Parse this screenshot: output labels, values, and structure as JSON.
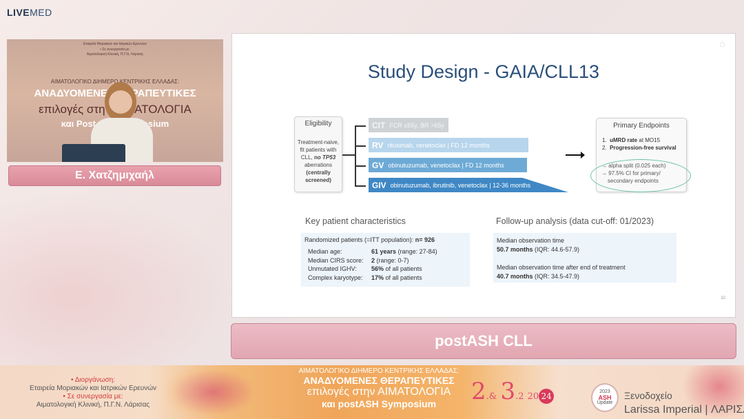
{
  "brand": {
    "part1": "LIVE",
    "part2": "MED"
  },
  "video": {
    "line1": "Εταιρεία Μοριακών και Ιατρικών Ερευνών",
    "line2": "• Σε συνεργασία με:",
    "line3": "Αιματολογική Κλινική, Π.Γ.Ν. Λάρισας",
    "line4": "ΑΙΜΑΤΟΛΟΓΙΚΟ ΔΙΗΜΕΡΟ ΚΕΝΤΡΙΚΗΣ ΕΛΛΑΔΑΣ:",
    "line5": "ΑΝΑΔΥΟΜΕΝΕΣ ΘΕΡΑΠΕΥΤΙΚΕΣ",
    "line6": "επιλογές στην ΑΙΜΑΤΟΛΟΓΙΑ",
    "line7": "και Post-Ash Symposium"
  },
  "speaker_name": "Ε. Χατζημιχαήλ",
  "slide": {
    "title": "Study Design - GAIA/CLL13",
    "eligibility": {
      "heading": "Eligibility",
      "text_a": "Treatment-naive, fit patients with CLL,",
      "no_label": "no",
      "tp53": "TP53",
      "text_b": "aberrations",
      "centrally": "(centrally screened)"
    },
    "arms": [
      {
        "code": "CIT",
        "desc": "FCR ≤65y, BR >65y"
      },
      {
        "code": "RV",
        "desc": "rituximab, venetoclax | FD 12 months"
      },
      {
        "code": "GV",
        "desc": "obinutuzumab, venetoclax | FD 12 months"
      },
      {
        "code": "GIV",
        "desc": "obinutuzumab, ibrutinib, venetoclax | 12-36 months"
      }
    ],
    "primary_endpoints": {
      "heading": "Primary Endpoints",
      "item1_num": "1.",
      "item1_bold": "uMRD rate",
      "item1_rest": "at MO15",
      "item2_num": "2.",
      "item2_bold": "Progression-free survival",
      "sub1": "→ alpha split (0.025 each)",
      "sub2": "→ 97.5% CI for primary/",
      "sub3": "secondary endpoints"
    },
    "kpc": {
      "title": "Key patient characteristics",
      "randomized_label": "Randomized patients (=ITT population):",
      "randomized_value": "n= 926",
      "rows": [
        {
          "label": "Median age:",
          "bold": "61 years",
          "rest": "(range: 27-84)"
        },
        {
          "label": "Median CIRS score:",
          "bold": "2",
          "rest": "(range: 0-7)"
        },
        {
          "label": "Unmutated IGHV:",
          "bold": "56%",
          "rest": "of all patients"
        },
        {
          "label": "Complex karyotype:",
          "bold": "17%",
          "rest": "of all patients"
        }
      ]
    },
    "followup": {
      "title": "Follow-up analysis (data cut-off: 01/2023)",
      "label1": "Median observation time",
      "bold1": "50.7 months",
      "rest1": "(IQR: 44.6-57.9)",
      "label2": "Median observation time after end of treatment",
      "bold2": "40.7 months",
      "rest2": "(IQR: 34.5-47.9)"
    },
    "page_number": "32"
  },
  "banner_title": "postASH CLL",
  "footer": {
    "organize_label": "• Διοργάνωση:",
    "organizer": "Εταιρεία Μοριακών και Ιατρικών Ερευνών",
    "collab_label": "• Σε συνεργασία με:",
    "collaborator": "Αιματολογική Κλινική, Π.Γ.Ν. Λάρισας",
    "center_line1": "ΑΙΜΑΤΟΛΟΓΙΚΟ ΔΙΗΜΕΡΟ ΚΕΝΤΡΙΚΗΣ ΕΛΛΑΔΑΣ:",
    "center_line2": "ΑΝΑΔΥΟΜΕΝΕΣ ΘΕΡΑΠΕΥΤΙΚΕΣ",
    "center_line3": "επιλογές στην ΑΙΜΑΤΟΛΟΓΙΑ",
    "center_line4": "και postASH Symposium",
    "date_d1": "2",
    "date_amp": ".&",
    "date_d2": "3",
    "date_m": ".2",
    "date_y1": "20",
    "date_y2": "24",
    "badge_year": "2023",
    "badge_ash": "ASH",
    "badge_update": "Update",
    "hotel_label": "Ξενοδοχείο",
    "hotel_name": "Larissa Imperial",
    "hotel_sep": "|",
    "hotel_city": "ΛΑΡΙΣΑ"
  }
}
